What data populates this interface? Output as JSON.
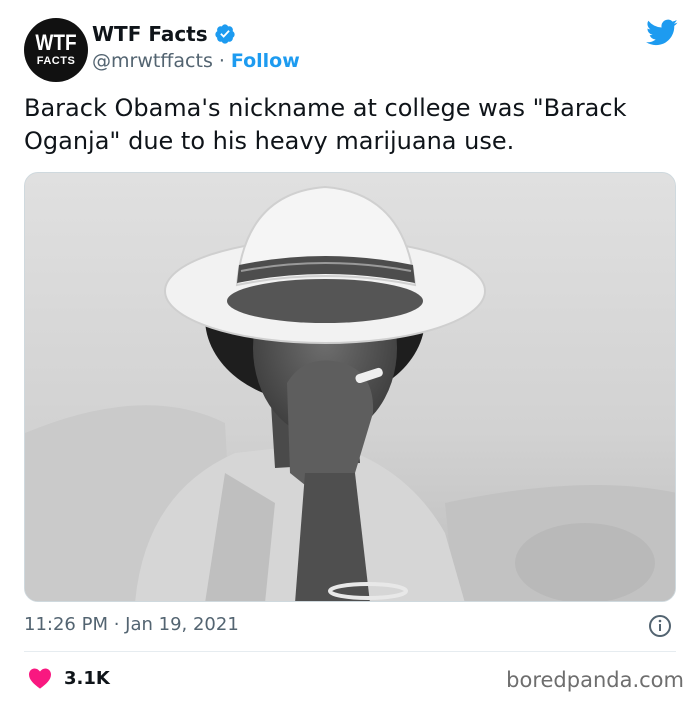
{
  "account": {
    "avatar_line1": "WTF",
    "avatar_line2": "FACTS",
    "display_name": "WTF Facts",
    "handle": "@mrwtffacts",
    "separator": "·",
    "follow_label": "Follow"
  },
  "tweet": {
    "text": "Barack Obama's nickname at college was \"Barack Oganja\" due to his heavy marijuana use.",
    "timestamp": "11:26 PM · Jan 19, 2021",
    "like_count": "3.1K"
  },
  "watermark": "boredpanda.com",
  "icons": {
    "verified": "verified-badge-icon",
    "brand": "twitter-bird-icon",
    "info": "info-icon",
    "like": "heart-icon"
  },
  "colors": {
    "link_blue": "#1d9bf0",
    "heart_red": "#f91880",
    "secondary_text": "#536471"
  }
}
